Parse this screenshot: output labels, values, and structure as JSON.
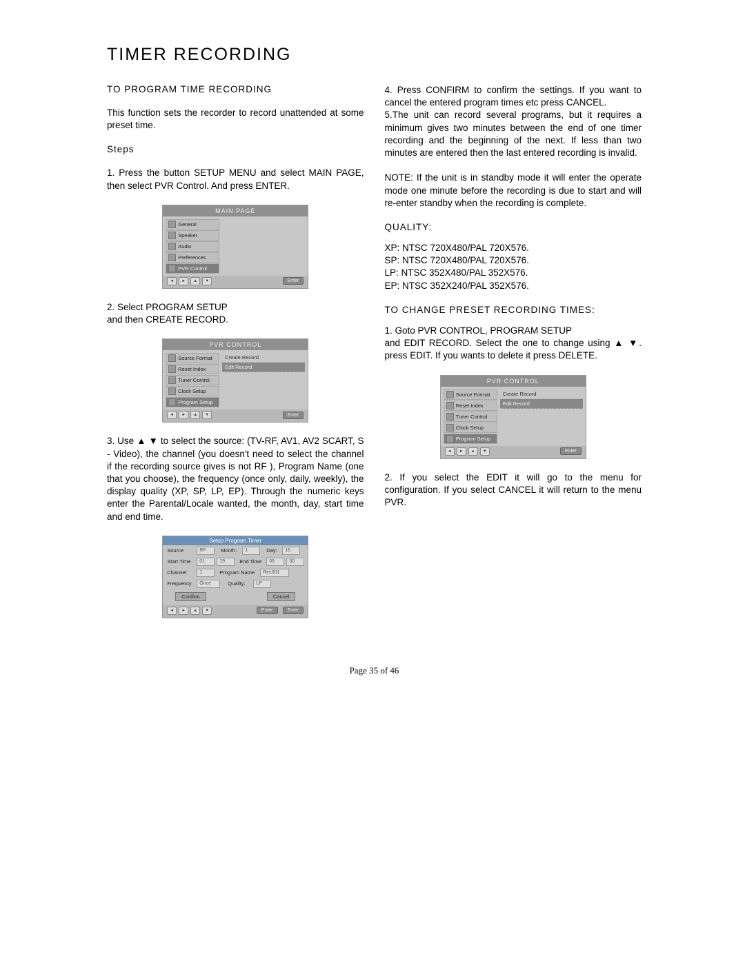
{
  "title": "TIMER RECORDING",
  "left": {
    "subhead1": "TO PROGRAM TIME RECORDING",
    "intro": "This function sets the recorder to record unattended at some preset time.",
    "stepsLabel": "Steps",
    "step1": "1. Press the button SETUP MENU and select MAIN PAGE, then select PVR Control. And press ENTER.",
    "step2a": "2. Select PROGRAM SETUP",
    "step2b": "and then CREATE RECORD.",
    "step3": "3. Use ▲ ▼ to select the source: (TV-RF, AV1, AV2 SCART, S - Video), the channel (you doesn't need to select the channel if the recording source gives is not RF ), Program Name (one that you choose), the frequency (once only, daily, weekly), the display quality (XP, SP, LP, EP). Through the numeric keys enter the Parental/Locale wanted, the month, day, start time and end time."
  },
  "right": {
    "step4": "4. Press CONFIRM to confirm the settings. If you want to cancel the entered program times etc press CANCEL.",
    "step5": "5.The unit can record several programs, but it requires a minimum gives two minutes between the end of one timer recording and the beginning of the next. If less than two minutes are entered then the last entered recording is invalid.",
    "note": "NOTE: If the unit is in standby mode it will enter the operate mode one minute before the recording is due to start and will re-enter standby when the recording is complete.",
    "qualityLabel": "QUALITY:",
    "q1": "XP: NTSC 720X480/PAL 720X576.",
    "q2": "SP: NTSC 720X480/PAL 720X576.",
    "q3": "LP: NTSC 352X480/PAL 352X576.",
    "q4": "EP: NTSC 352X240/PAL 352X576.",
    "changeHead": "TO CHANGE PRESET RECORDING TIMES:",
    "change1a": "1. Goto PVR CONTROL, PROGRAM SETUP",
    "change1b": "and EDIT RECORD. Select the one to change using ▲ ▼. press EDIT. If you wants to delete it press DELETE.",
    "change2": "2. If you select the EDIT it will go to the menu for configuration. If you select CANCEL it will return to the menu PVR."
  },
  "shots": {
    "mainPage": {
      "title": "MAIN PAGE",
      "items": [
        "General",
        "Speaker",
        "Audio",
        "Preferences",
        "PVR Control"
      ],
      "enter": "Enter"
    },
    "pvrControl": {
      "title": "PVR CONTROL",
      "items": [
        "Source Format",
        "Reset Index",
        "Tuner Control",
        "Clock Setup",
        "Program Setup"
      ],
      "sub": [
        "Create Record",
        "Edit Record"
      ],
      "enter": "Enter"
    },
    "timerForm": {
      "title": "Setup Program Timer",
      "labels": {
        "source": "Source",
        "month": "Month:",
        "day": "Day:",
        "startTime": "Start Time",
        "endTime": "End Time",
        "channel": "Channel",
        "programName": "Program Name",
        "frequency": "Frequency",
        "quality": "Quality:",
        "confirm": "Confirm",
        "cancel": "Cancel"
      },
      "values": {
        "source": "RF",
        "month": "1",
        "day": "16",
        "st1": "01",
        "st2": "19",
        "et1": "06",
        "et2": "30",
        "channel": "1",
        "programName": "Rec001",
        "frequency": "Once",
        "quality": "LP"
      }
    }
  },
  "pageNum": "Page 35 of 46"
}
